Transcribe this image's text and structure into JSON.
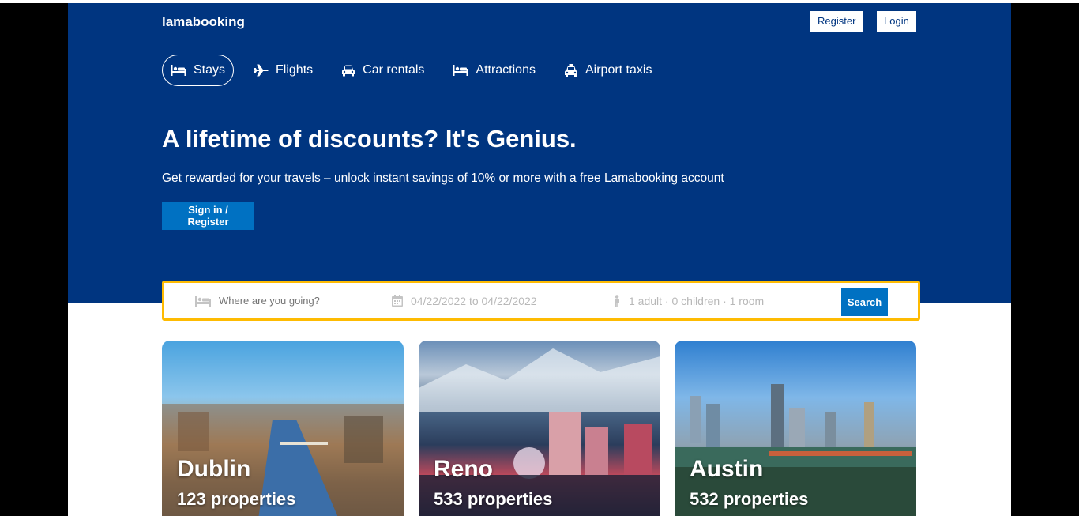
{
  "header": {
    "logo": "lamabooking",
    "register_label": "Register",
    "login_label": "Login"
  },
  "nav": {
    "tabs": [
      {
        "label": "Stays",
        "icon": "bed-icon",
        "active": true
      },
      {
        "label": "Flights",
        "icon": "plane-icon",
        "active": false
      },
      {
        "label": "Car rentals",
        "icon": "car-icon",
        "active": false
      },
      {
        "label": "Attractions",
        "icon": "bed-icon",
        "active": false
      },
      {
        "label": "Airport taxis",
        "icon": "taxi-icon",
        "active": false
      }
    ]
  },
  "hero": {
    "title": "A lifetime of discounts? It's Genius.",
    "description": "Get rewarded for your travels – unlock instant savings of 10% or more with a free Lamabooking account",
    "signin_label": "Sign in / Register"
  },
  "search": {
    "destination_placeholder": "Where are you going?",
    "dates": "04/22/2022 to 04/22/2022",
    "options": "1 adult · 0 children · 1 room",
    "button_label": "Search"
  },
  "featured": [
    {
      "city": "Dublin",
      "properties": "123 properties"
    },
    {
      "city": "Reno",
      "properties": "533 properties"
    },
    {
      "city": "Austin",
      "properties": "532 properties"
    }
  ],
  "colors": {
    "brand": "#003580",
    "accent": "#0071c2",
    "search_border": "#febb02"
  }
}
